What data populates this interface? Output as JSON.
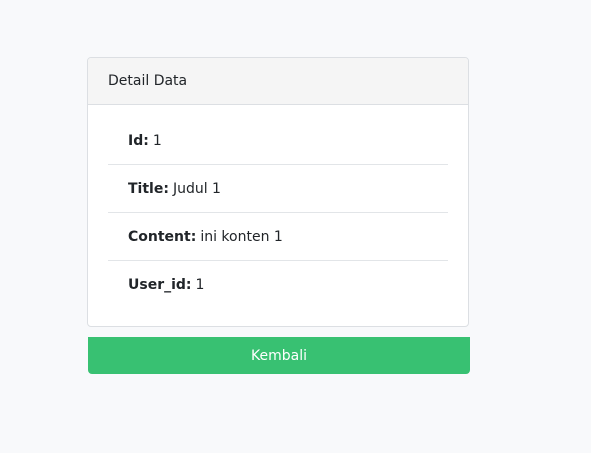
{
  "card": {
    "title": "Detail Data",
    "fields": [
      {
        "label": "Id:",
        "value": "1"
      },
      {
        "label": "Title:",
        "value": "Judul 1"
      },
      {
        "label": "Content:",
        "value": "ini konten 1"
      },
      {
        "label": "User_id:",
        "value": "1"
      }
    ]
  },
  "actions": {
    "back_label": "Kembali"
  },
  "colors": {
    "background": "#f8f9fb",
    "header_background": "#f5f5f5",
    "button_green": "#38c172",
    "button_text": "#ffffff"
  }
}
